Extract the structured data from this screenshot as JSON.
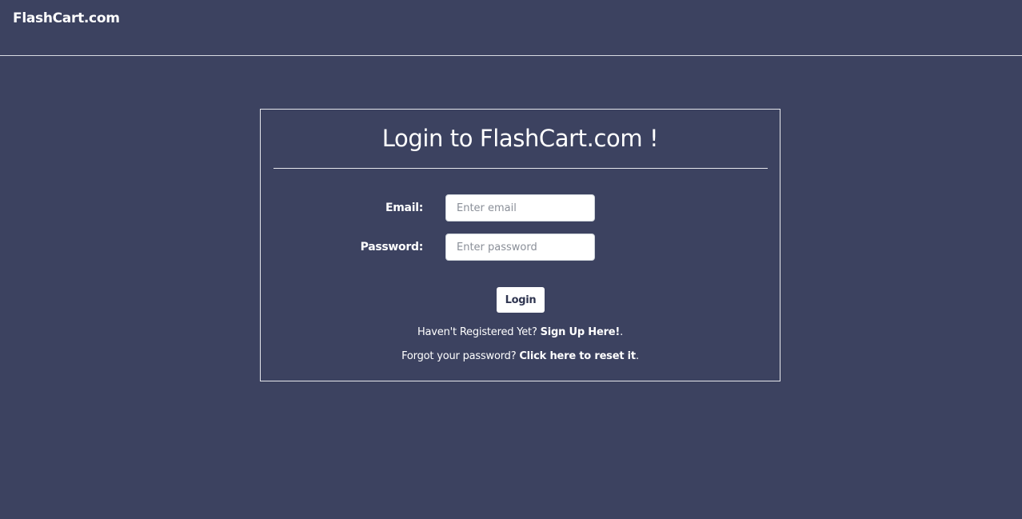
{
  "header": {
    "brand": "FlashCart.com"
  },
  "login_card": {
    "title": "Login to FlashCart.com !",
    "email_label": "Email:",
    "email_placeholder": "Enter email",
    "email_value": "",
    "password_label": "Password:",
    "password_placeholder": "Enter password",
    "password_value": "",
    "login_button": "Login",
    "signup_prompt": "Haven't Registered Yet? ",
    "signup_link": "Sign Up Here!",
    "signup_suffix": ".",
    "reset_prompt": "Forgot your password? ",
    "reset_link": "Click here to reset it",
    "reset_suffix": "."
  },
  "colors": {
    "background": "#3c4260",
    "text": "#ffffff",
    "button_text": "#2f3550"
  }
}
